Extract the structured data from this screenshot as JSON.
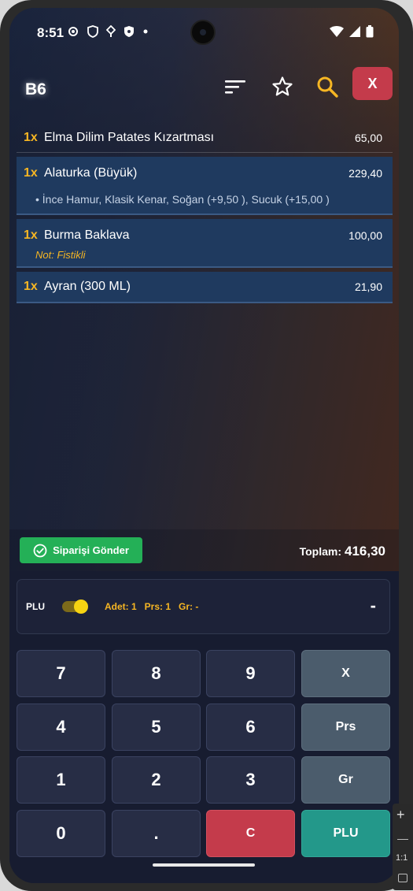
{
  "status_bar": {
    "time": "8:51"
  },
  "app_bar": {
    "table_title": "B6",
    "close_label": "X"
  },
  "order_items": [
    {
      "qty": "1x",
      "name": "Elma Dilim Patates Kızartması",
      "price": "65,00"
    },
    {
      "qty": "1x",
      "name": "Alaturka (Büyük)",
      "price": "229,40",
      "options": "• İnce Hamur, Klasik Kenar, Soğan (+9,50 ), Sucuk (+15,00 )"
    },
    {
      "qty": "1x",
      "name": "Burma Baklava",
      "price": "100,00",
      "note": "Not: Fistikli"
    },
    {
      "qty": "1x",
      "name": "Ayran (300 ML)",
      "price": "21,90"
    }
  ],
  "send_bar": {
    "send_label": "Siparişi Gönder",
    "total_label": "Toplam:",
    "total_value": "416,30"
  },
  "plu_panel": {
    "label": "PLU",
    "toggle_on": true,
    "adet": "Adet: 1",
    "prs": "Prs: 1",
    "gr": "Gr: -",
    "display": "-"
  },
  "keypad": {
    "keys": [
      "7",
      "8",
      "9",
      "X",
      "4",
      "5",
      "6",
      "Prs",
      "1",
      "2",
      "3",
      "Gr",
      "0",
      ".",
      "C",
      "PLU"
    ]
  },
  "emulator_tools": {
    "ratio": "1:1"
  },
  "colors": {
    "accent": "#f6b623",
    "close": "#c43b4b",
    "send": "#24b057",
    "plu_key": "#23988a"
  }
}
